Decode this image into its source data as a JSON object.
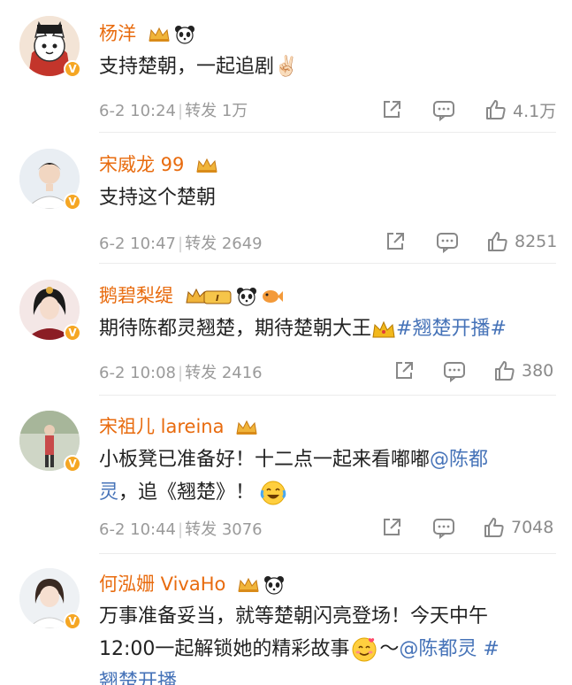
{
  "comments": [
    {
      "username": "杨洋",
      "content": "支持楚朝，一起追剧✌🏻",
      "date_time": "6-2 10:24",
      "repost_label": "转发",
      "repost_count": "1万",
      "like_count": "4.1万",
      "badges": [
        "crown-badge-icon",
        "panda-icon"
      ]
    },
    {
      "username": "宋威龙 99",
      "content": "支持这个楚朝",
      "date_time": "6-2 10:47",
      "repost_label": "转发",
      "repost_count": "2649",
      "like_count": "8251",
      "badges": [
        "crown-badge-icon"
      ]
    },
    {
      "username": "鹅碧梨缇",
      "content_text": "期待陈都灵翘楚，期待楚朝大王",
      "content_topic": "#翘楚开播#",
      "date_time": "6-2 10:08",
      "repost_label": "转发",
      "repost_count": "2416",
      "like_count": "380",
      "badges": [
        "crown-level-badge-icon",
        "panda-icon",
        "fish-icon"
      ]
    },
    {
      "username": "宋祖儿 lareina",
      "content_line1": "小板凳已准备好！十二点一起来看嘟嘟",
      "mention": "@陈都",
      "content_line2_mention": "灵",
      "content_line2": "，追《翘楚》！",
      "date_time": "6-2 10:44",
      "repost_label": "转发",
      "repost_count": "3076",
      "like_count": "7048",
      "badges": [
        "crown-badge-icon"
      ]
    },
    {
      "username": "何泓姗 VivaHo",
      "content_line1": "万事准备妥当，就等楚朝闪亮登场！今天中午",
      "content_line2": "12:00一起解锁她的精彩故事",
      "content_line2_tail": "～",
      "mention": "@陈都灵 #",
      "content_line3": "翘楚开播",
      "badges": [
        "crown-badge-icon",
        "panda-icon"
      ]
    }
  ],
  "colors": {
    "username": "#e86b0e",
    "link": "#4673b8",
    "meta": "#9a9a9a"
  }
}
